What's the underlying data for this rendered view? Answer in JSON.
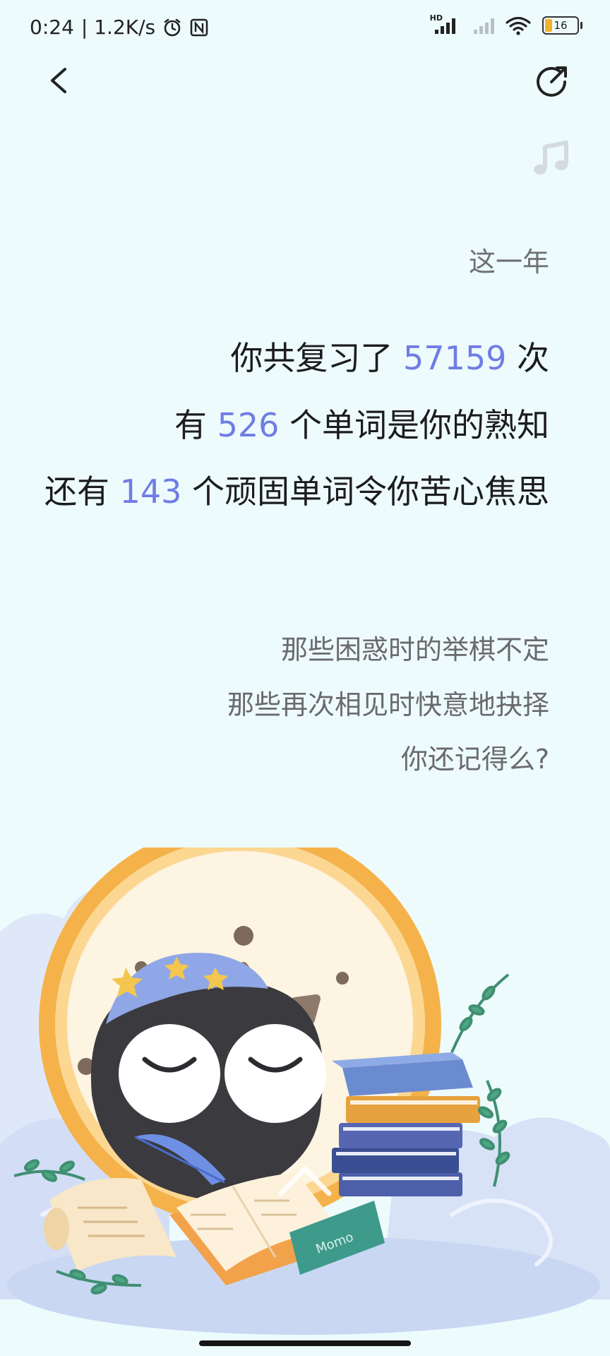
{
  "status_bar": {
    "time": "0:24",
    "net_speed": "| 1.2K/s",
    "signal_label": "HD",
    "battery": "16"
  },
  "report": {
    "intro": "这一年",
    "line1": {
      "prefix": "你共复习了 ",
      "value": "57159",
      "suffix": " 次"
    },
    "line2": {
      "prefix": "有 ",
      "value": "526",
      "suffix": " 个单词是你的熟知"
    },
    "line3": {
      "prefix": "还有 ",
      "value": "143",
      "suffix": " 个顽固单词令你苦心焦思"
    },
    "poem": [
      "那些困惑时的举棋不定",
      "那些再次相见时快意地抉择",
      "你还记得么?"
    ]
  },
  "icons": {
    "back": "chevron-left-icon",
    "share": "share-icon",
    "music": "music-note-icon"
  },
  "colors": {
    "background": "#eefbfc",
    "accent_number": "#6f7de4",
    "primary_text": "#1c1c1e",
    "secondary_text": "#6a6a6e"
  },
  "illustration": {
    "book_spine_text": "Momo"
  }
}
